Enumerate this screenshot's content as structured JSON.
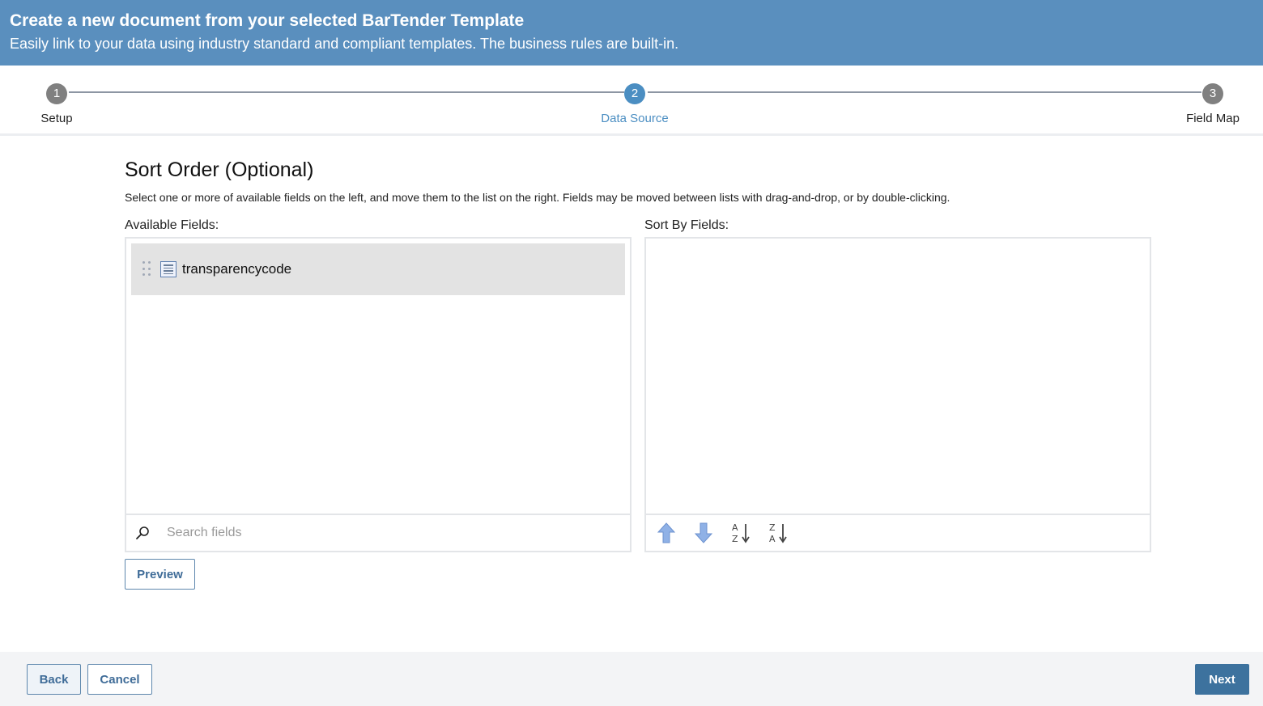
{
  "header": {
    "title": "Create a new document from your selected BarTender Template",
    "subtitle": "Easily link to your data using industry standard and compliant templates. The business rules are built-in."
  },
  "stepper": {
    "steps": [
      {
        "number": "1",
        "label": "Setup",
        "state": "done"
      },
      {
        "number": "2",
        "label": "Data Source",
        "state": "active"
      },
      {
        "number": "3",
        "label": "Field Map",
        "state": "pending"
      }
    ],
    "active_color": "#4b8ec2"
  },
  "sort_order": {
    "title": "Sort Order (Optional)",
    "description": "Select one or more of available fields on the left, and move them to the list on the right. Fields may be moved between lists with drag-and-drop, or by double-clicking.",
    "available_label": "Available Fields:",
    "sort_by_label": "Sort By Fields:",
    "available_fields": [
      {
        "name": "transparencycode",
        "icon": "field-icon"
      }
    ],
    "sort_by_fields": [],
    "search": {
      "placeholder": "Search fields",
      "value": ""
    },
    "tools": [
      {
        "name": "move-up-icon"
      },
      {
        "name": "move-down-icon"
      },
      {
        "name": "sort-ascending-icon"
      },
      {
        "name": "sort-descending-icon"
      }
    ],
    "preview_label": "Preview"
  },
  "footer": {
    "back_label": "Back",
    "cancel_label": "Cancel",
    "next_label": "Next"
  },
  "colors": {
    "header_bg": "#5a8fbe",
    "primary_button": "#3d729e",
    "arrow_blue": "#8fb1e6"
  }
}
